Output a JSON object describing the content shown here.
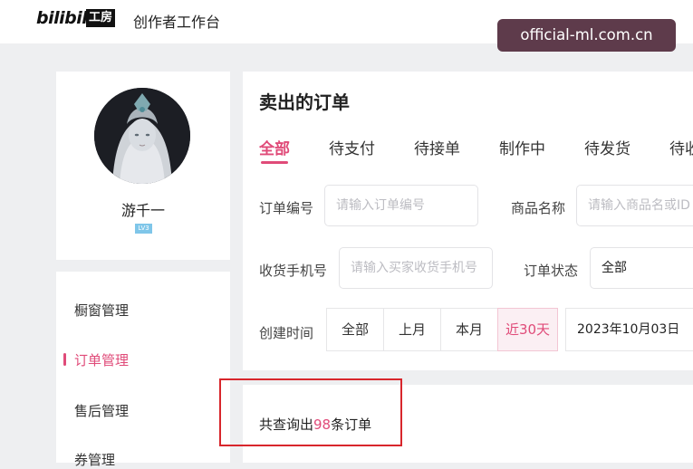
{
  "header": {
    "logo_text": "bilibili",
    "logo_box_text": "工房",
    "app_title": "创作者工作台"
  },
  "watermark": "official-ml.com.cn",
  "profile": {
    "username": "游千一",
    "level_badge": "LV3"
  },
  "sidebar": {
    "items": [
      {
        "label": "橱窗管理",
        "active": false
      },
      {
        "label": "订单管理",
        "active": true
      },
      {
        "label": "售后管理",
        "active": false
      },
      {
        "label": "券管理",
        "active": false
      }
    ]
  },
  "main": {
    "title": "卖出的订单",
    "tabs": [
      {
        "label": "全部",
        "active": true
      },
      {
        "label": "待支付",
        "active": false
      },
      {
        "label": "待接单",
        "active": false
      },
      {
        "label": "制作中",
        "active": false
      },
      {
        "label": "待发货",
        "active": false
      },
      {
        "label": "待收",
        "active": false
      }
    ],
    "filters": {
      "order_no_label": "订单编号",
      "order_no_placeholder": "请输入订单编号",
      "product_label": "商品名称",
      "product_placeholder": "请输入商品名或ID",
      "phone_label": "收货手机号",
      "phone_placeholder": "请输入买家收货手机号",
      "status_label": "订单状态",
      "status_value": "全部",
      "created_label": "创建时间",
      "date_options": [
        {
          "label": "全部",
          "active": false
        },
        {
          "label": "上月",
          "active": false
        },
        {
          "label": "本月",
          "active": false
        },
        {
          "label": "近30天",
          "active": true
        }
      ],
      "date_start": "2023年10月03日"
    }
  },
  "results": {
    "prefix": "共查询出",
    "count": "98",
    "suffix": "条订单"
  },
  "colors": {
    "accent": "#e04b79",
    "highlight_border": "#d8262c",
    "watermark_bg": "#5e3b4b"
  }
}
